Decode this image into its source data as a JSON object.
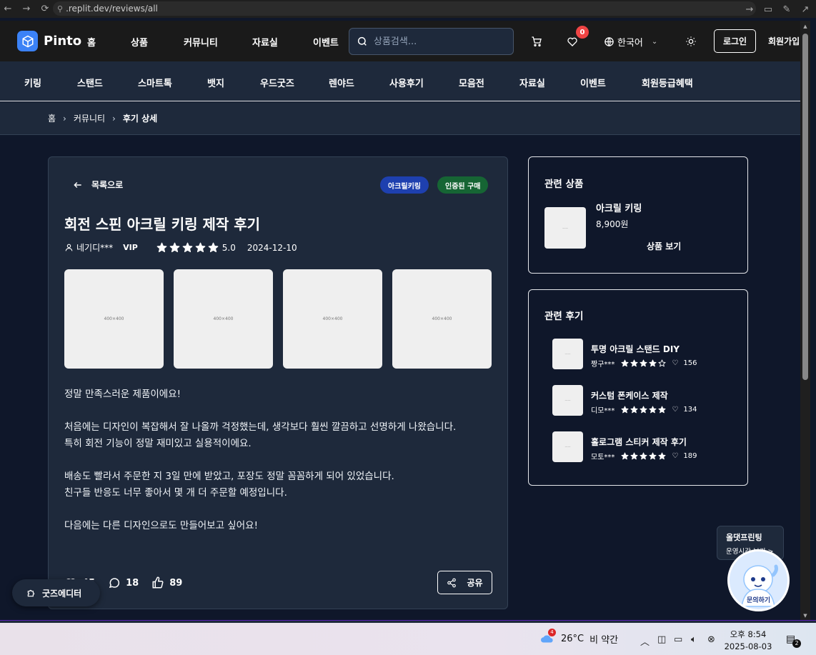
{
  "browser": {
    "url": ".replit.dev/reviews/all"
  },
  "header": {
    "logo": "Pinto",
    "nav": [
      "홈",
      "상품",
      "커뮤니티",
      "자료실",
      "이벤트"
    ],
    "search_placeholder": "상품검색...",
    "wishlist_count": "0",
    "language": "한국어",
    "login": "로그인",
    "signup": "회원가입"
  },
  "subnav": [
    "키링",
    "스탠드",
    "스마트톡",
    "뱃지",
    "우드굿즈",
    "렌야드",
    "사용후기",
    "모음전",
    "자료실",
    "이벤트",
    "회원등급혜택"
  ],
  "breadcrumb": [
    "홈",
    "커뮤니티",
    "후기 상세"
  ],
  "review": {
    "back_label": "목록으로",
    "tags": [
      "아크릴키링",
      "인증된 구매"
    ],
    "title": "회전 스핀 아크릴 키링 제작 후기",
    "author": "네기디***",
    "grade": "VIP",
    "rating": 5,
    "rating_text": "5.0",
    "date": "2024-12-10",
    "photos": [
      "400×400",
      "400×400",
      "400×400",
      "400×400"
    ],
    "body": [
      "정말 만족스러운 제품이에요!",
      "",
      "처음에는 디자인이 복잡해서 잘 나올까 걱정했는데, 생각보다 훨씬 깔끔하고 선명하게 나왔습니다.",
      "특히 회전 기능이 정말 재미있고 실용적이에요.",
      "",
      "배송도 빨라서 주문한 지 3일 만에 받았고, 포장도 정말 꼼꼼하게 되어 있었습니다.",
      "친구들 반응도 너무 좋아서 몇 개 더 주문할 예정입니다.",
      "",
      "다음에는 다른 디자인으로도 만들어보고 싶어요!"
    ],
    "likes": "45",
    "comments": "18",
    "helpful": "89",
    "share_label": "공유"
  },
  "related_product": {
    "heading": "관련 상품",
    "name": "아크릴 키링",
    "price": "8,900원",
    "view_label": "상품 보기"
  },
  "related_reviews": {
    "heading": "관련 후기",
    "items": [
      {
        "title": "투명 아크릴 스탠드 DIY",
        "author": "짱구***",
        "rating": 4,
        "likes": "156"
      },
      {
        "title": "커스텀 폰케이스 제작",
        "author": "디모***",
        "rating": 5,
        "likes": "134"
      },
      {
        "title": "홀로그램 스티커 제작 후기",
        "author": "모토***",
        "rating": 5,
        "likes": "189"
      }
    ]
  },
  "floating": {
    "goods_editor": "굿즈에디터",
    "chat_title": "올댓프린팅",
    "chat_hours": "운영시간 보기 >",
    "chat_button": "문의하기"
  },
  "taskbar": {
    "weather_badge": "4",
    "temperature": "26°C",
    "condition": "비 약간",
    "time": "오후 8:54",
    "date": "2025-08-03",
    "notifications": "2"
  },
  "colors": {
    "accent": "#3b82f6",
    "badge": "#ef4444",
    "tag_blue": "#1e40af",
    "tag_green": "#166534",
    "page_bg": "#0f172a",
    "card_bg": "#1e293b"
  }
}
